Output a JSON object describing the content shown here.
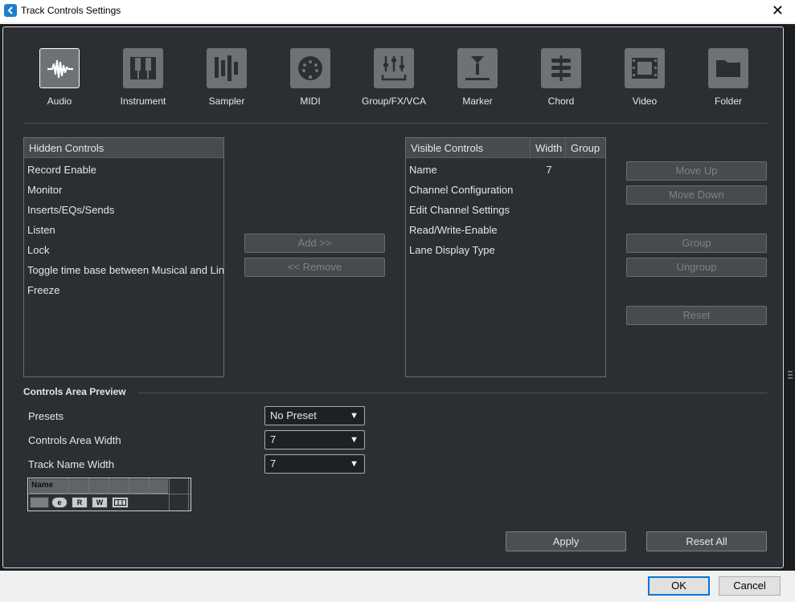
{
  "window": {
    "title": "Track Controls Settings"
  },
  "tabs": [
    {
      "label": "Audio",
      "icon": "audio-waveform-icon",
      "active": true
    },
    {
      "label": "Instrument",
      "icon": "piano-keys-icon"
    },
    {
      "label": "Sampler",
      "icon": "sampler-bars-icon"
    },
    {
      "label": "MIDI",
      "icon": "midi-connector-icon"
    },
    {
      "label": "Group/FX/VCA",
      "icon": "faders-icon"
    },
    {
      "label": "Marker",
      "icon": "marker-icon"
    },
    {
      "label": "Chord",
      "icon": "chord-icon"
    },
    {
      "label": "Video",
      "icon": "film-icon"
    },
    {
      "label": "Folder",
      "icon": "folder-icon"
    }
  ],
  "hidden_controls": {
    "header": "Hidden Controls",
    "items": [
      "Record Enable",
      "Monitor",
      "Inserts/EQs/Sends",
      "Listen",
      "Lock",
      "Toggle time base between Musical and Linear",
      "Freeze"
    ]
  },
  "transfer": {
    "add": "Add >>",
    "remove": "<< Remove"
  },
  "visible_controls": {
    "headers": [
      "Visible Controls",
      "Width",
      "Group"
    ],
    "rows": [
      {
        "name": "Name",
        "width": "7",
        "group": ""
      },
      {
        "name": "Channel Configuration",
        "width": "",
        "group": ""
      },
      {
        "name": "Edit Channel Settings",
        "width": "",
        "group": ""
      },
      {
        "name": "Read/Write-Enable",
        "width": "",
        "group": ""
      },
      {
        "name": "Lane Display Type",
        "width": "",
        "group": ""
      }
    ]
  },
  "side_buttons": {
    "move_up": "Move Up",
    "move_down": "Move Down",
    "group": "Group",
    "ungroup": "Ungroup",
    "reset": "Reset"
  },
  "preview": {
    "title": "Controls Area Preview",
    "presets_label": "Presets",
    "presets_value": "No Preset",
    "area_width_label": "Controls Area Width",
    "area_width_value": "7",
    "name_width_label": "Track Name Width",
    "name_width_value": "7",
    "strip_name": "Name",
    "strip_buttons": [
      "",
      "e",
      "R",
      "W",
      ""
    ]
  },
  "actions": {
    "apply": "Apply",
    "reset_all": "Reset All"
  },
  "dialog": {
    "ok": "OK",
    "cancel": "Cancel"
  }
}
